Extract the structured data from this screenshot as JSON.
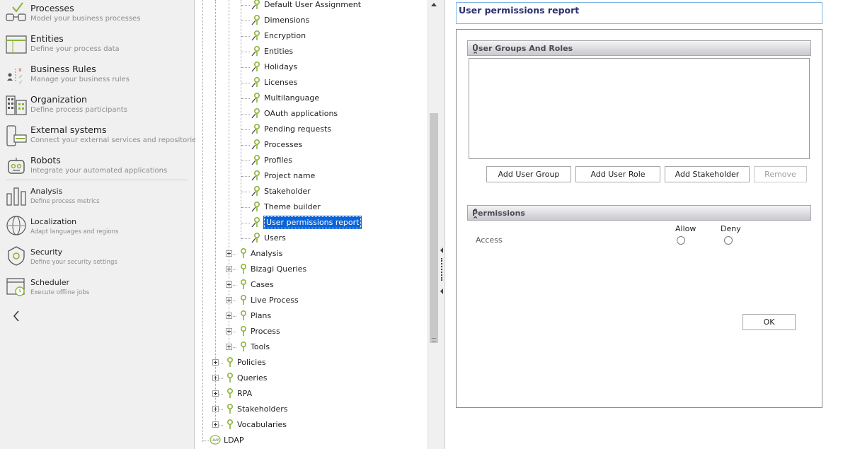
{
  "nav": {
    "items": [
      {
        "title": "Processes",
        "desc": "Model your business processes",
        "icon": "processes-icon"
      },
      {
        "title": "Entities",
        "desc": "Define your process data",
        "icon": "entities-icon"
      },
      {
        "title": "Business Rules",
        "desc": "Manage your business rules",
        "icon": "business-rules-icon"
      },
      {
        "title": "Organization",
        "desc": "Define process participants",
        "icon": "organization-icon"
      },
      {
        "title": "External systems",
        "desc": "Connect your external services and repositories",
        "icon": "external-systems-icon"
      },
      {
        "title": "Robots",
        "desc": "Integrate your automated applications",
        "icon": "robots-icon"
      },
      {
        "title": "Analysis",
        "desc": "Define process metrics",
        "icon": "analysis-icon"
      },
      {
        "title": "Localization",
        "desc": "Adapt languages and regions",
        "icon": "localization-icon"
      },
      {
        "title": "Security",
        "desc": "Define your security settings",
        "icon": "security-icon"
      },
      {
        "title": "Scheduler",
        "desc": "Execute offline jobs",
        "icon": "scheduler-icon"
      }
    ]
  },
  "tree": {
    "leaves": [
      "Default User Assignment",
      "Dimensions",
      "Encryption",
      "Entities",
      "Holidays",
      "Licenses",
      "Multilanguage",
      "OAuth applications",
      "Pending requests",
      "Processes",
      "Profiles",
      "Project name",
      "Stakeholder",
      "Theme builder",
      "User permissions report",
      "Users"
    ],
    "level2": [
      "Analysis",
      "Bizagi Queries",
      "Cases",
      "Live Process",
      "Plans",
      "Process",
      "Tools"
    ],
    "level1": [
      "Policies",
      "Queries",
      "RPA",
      "Stakeholders",
      "Vocabularies"
    ],
    "root": "LDAP",
    "root_badge": "LDAP"
  },
  "report": {
    "title": "User permissions report",
    "groups_header": "User Groups And Roles",
    "buttons": {
      "add_group": "Add User Group",
      "add_role": "Add User Role",
      "add_stakeholder": "Add Stakeholder",
      "remove": "Remove"
    },
    "permissions_header": "Permissions",
    "col_allow": "Allow",
    "col_deny": "Deny",
    "row_access": "Access",
    "ok": "OK"
  },
  "colors": {
    "accent_green": "#8bb43a",
    "selection": "#0a64d8",
    "title_text": "#2c2f6b"
  }
}
